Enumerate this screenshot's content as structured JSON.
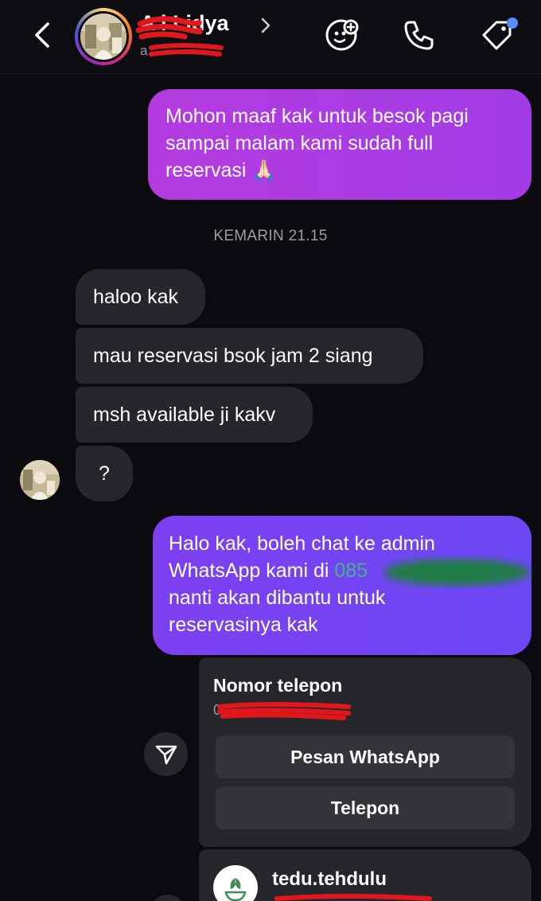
{
  "header": {
    "contact_name": "A   i Lidya",
    "contact_handle": "a",
    "icons": [
      "back-chevron-icon",
      "profile-chevron-icon",
      "sticker-game-icon",
      "phone-icon",
      "label-tag-icon"
    ],
    "notification_dot_color": "#5a8cf7"
  },
  "messages": {
    "outgoing_1": {
      "line_1": "Mohon maaf kak untuk besok pagi",
      "line_2": "sampai malam kami sudah full",
      "line_3": "reservasi 🙏🏻"
    },
    "timestamp": "KEMARIN 21.15",
    "incoming": [
      {
        "text": "haloo kak"
      },
      {
        "text": "mau reservasi bsok jam 2 siang"
      },
      {
        "text": "msh available ji kakv"
      },
      {
        "text": "?"
      }
    ],
    "outgoing_2": {
      "line_1": "Halo kak, boleh chat ke admin",
      "line_2_prefix": "WhatsApp kami di ",
      "line_2_number": "085",
      "line_3": "nanti akan dibantu untuk",
      "line_4": "reservasinya kak"
    }
  },
  "contact_card": {
    "title": "Nomor telepon",
    "phone": "0",
    "button_whatsapp": "Pesan WhatsApp",
    "button_call": "Telepon"
  },
  "business_card": {
    "name": "tedu.tehdulu"
  },
  "colors": {
    "outgoing_bubble_1": "#b43be0",
    "outgoing_bubble_2": "#7d3ff0",
    "incoming_bubble": "#26262b",
    "background": "#0b0b0f"
  }
}
